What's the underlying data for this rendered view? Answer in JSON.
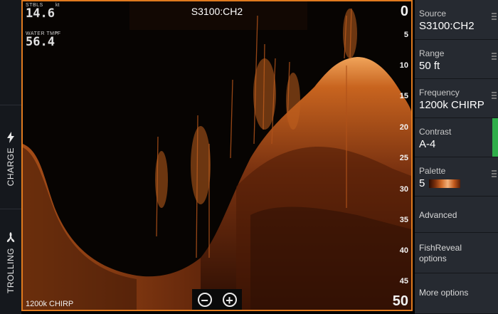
{
  "left_rail": {
    "charge_label": "CHARGE",
    "trolling_label": "TROLLING",
    "charge_icon": "lightning-bolt-icon",
    "trolling_icon": "propeller-icon"
  },
  "sonar": {
    "title": "S3100:CH2",
    "fields": [
      {
        "label": "STBLS",
        "unit": "kt",
        "value": "14.6"
      },
      {
        "label": "WATER TMP",
        "unit": "°F",
        "value": "56.4"
      }
    ],
    "depth_top": "0",
    "depth_ticks": [
      "5",
      "10",
      "15",
      "20",
      "25",
      "30",
      "35",
      "40",
      "45"
    ],
    "depth_bottom": "50",
    "frequency_label": "1200k CHIRP",
    "zoom_out_symbol": "−",
    "zoom_in_symbol": "+",
    "accent_color": "#e07a1e"
  },
  "menu": {
    "source": {
      "label": "Source",
      "value": "S3100:CH2"
    },
    "range": {
      "label": "Range",
      "value": "50 ft"
    },
    "frequency": {
      "label": "Frequency",
      "value": "1200k CHIRP"
    },
    "contrast": {
      "label": "Contrast",
      "value": "A-4"
    },
    "palette": {
      "label": "Palette",
      "value": "5"
    },
    "advanced": "Advanced",
    "fishreveal_line1": "FishReveal",
    "fishreveal_line2": "options",
    "more_options": "More options",
    "active_color": "#2fae4a"
  }
}
